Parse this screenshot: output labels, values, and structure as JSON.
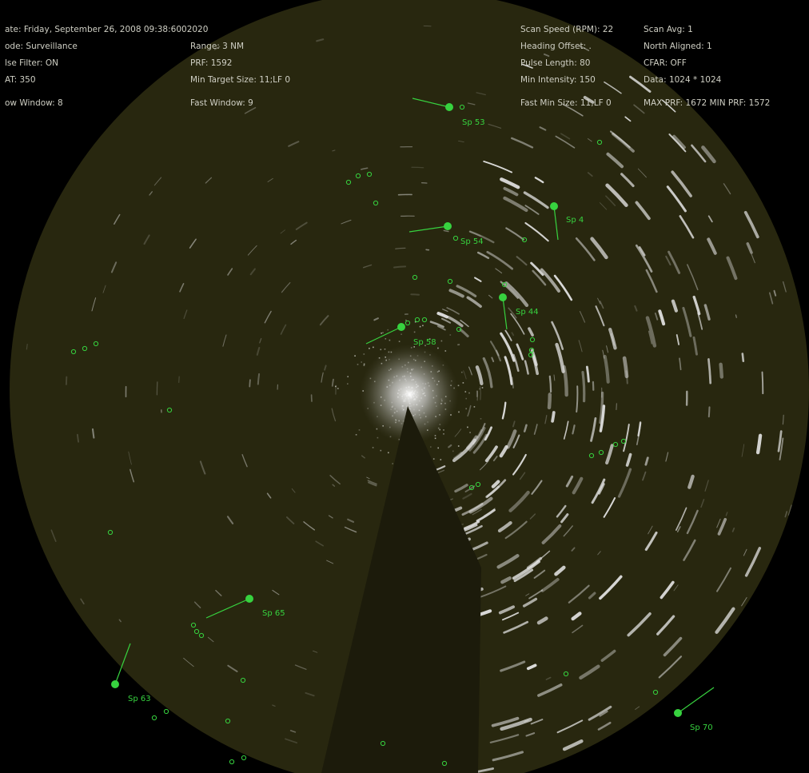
{
  "status": {
    "col1": [
      "ate: Friday, September 26, 2008 09:38:6002020",
      "ode: Surveillance",
      "lse Filter: ON",
      "AT: 350",
      "ow Window: 8"
    ],
    "col2": [
      "Range: 3 NM",
      "PRF: 1592",
      "Min Target Size: 11;LF 0",
      "Fast Window: 9"
    ],
    "col3": [
      "Scan Speed (RPM): 22",
      "Heading Offset: .",
      "Pulse Length: 80",
      "Min Intensity: 150",
      "Fast Min Size: 11;LF 0"
    ],
    "col4": [
      "Scan Avg: 1",
      "North Aligned: 1",
      "CFAR: OFF",
      "Data: 1024 * 1024",
      "MAX PRF: 1672 MIN PRF: 1572"
    ]
  },
  "tracks": [
    {
      "label": "Sp 53"
    },
    {
      "label": "Sp 4"
    },
    {
      "label": "Sp 54"
    },
    {
      "label": "Sp 44"
    },
    {
      "label": "Sp 58"
    },
    {
      "label": "Sp 65"
    },
    {
      "label": "Sp 63"
    },
    {
      "label": "Sp 70"
    }
  ],
  "colors": {
    "scope_bg": "#28270f",
    "echo": "#e6e6e6",
    "track": "#37d23f",
    "text": "#cfcfc4"
  }
}
